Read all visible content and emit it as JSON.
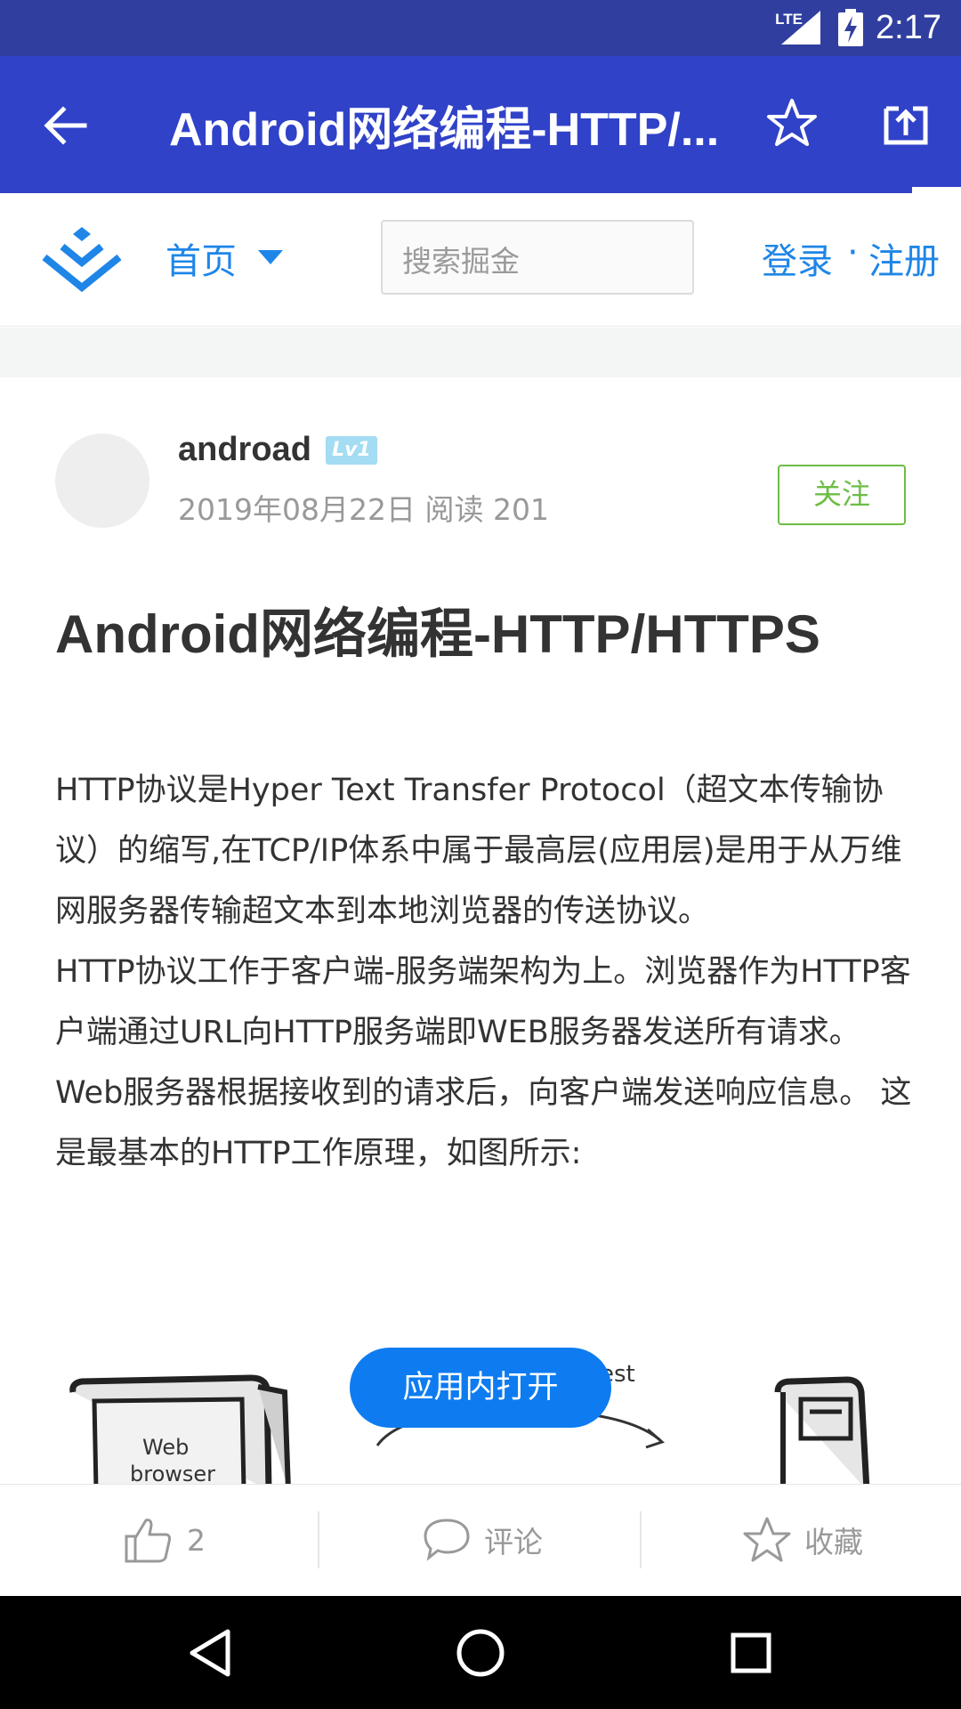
{
  "status_bar": {
    "network": "LTE",
    "time": "2:17"
  },
  "app_bar": {
    "title": "Android网络编程-HTTP/..."
  },
  "site_header": {
    "nav_home": "首页",
    "search_placeholder": "搜索掘金",
    "login": "登录",
    "separator": "·",
    "register": "注册"
  },
  "article": {
    "author": "androad",
    "level": "Lv1",
    "meta": "2019年08月22日  阅读 201",
    "follow_label": "关注",
    "title": "Android网络编程-HTTP/HTTPS",
    "paragraph1": "HTTP协议是Hyper Text Transfer Protocol（超文本传输协议）的缩写,在TCP/IP体系中属于最高层(应用层)是用于从万维网服务器传输超文本到本地浏览器的传送协议。",
    "paragraph2": "HTTP协议工作于客户端-服务端架构为上。浏览器作为HTTP客户端通过URL向HTTP服务端即WEB服务器发送所有请求。Web服务器根据接收到的请求后，向客户端发送响应信息。 这是最基本的HTTP工作原理，如图所示:",
    "image_text": {
      "browser_line1": "Web",
      "browser_line2": "browser",
      "arrow_label": "est"
    }
  },
  "open_in_app": "应用内打开",
  "action_bar": {
    "like_count": "2",
    "comment_label": "评论",
    "collect_label": "收藏"
  },
  "colors": {
    "status_bar": "#303F9F",
    "app_bar": "#3042C8",
    "link_blue": "#1F86E8",
    "follow_green": "#6CBD45",
    "open_button": "#0E7CF0"
  }
}
